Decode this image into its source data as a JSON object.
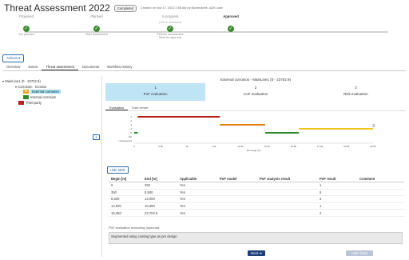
{
  "header": {
    "title": "Threat Assessment 2022",
    "badge": "Completed",
    "created": "Created on Nov 17, 2022 2:58 AM by Bumteckedt, AZM Lake"
  },
  "stepper": {
    "steps": [
      {
        "label": "Proposed",
        "sub": "",
        "action": "Set planned"
      },
      {
        "label": "Planned",
        "sub": "",
        "action": "Start assessment"
      },
      {
        "label": "In progress",
        "sub": "(100 % assessed)",
        "action": "Perform assessment\nSend for approval"
      },
      {
        "label": "Approved",
        "sub": "",
        "action": ""
      }
    ]
  },
  "actions_label": "Actions",
  "tabs": [
    "Overview",
    "Extent",
    "Threat assessment",
    "Documents",
    "Workflow History"
  ],
  "tree": {
    "root": "MainLine1 (0 - 23702.9)",
    "group": "Corrosion - Erosion",
    "items": [
      {
        "code": "M",
        "label": "External corrosion",
        "color": "#e8a21a",
        "selected": true
      },
      {
        "code": "",
        "label": "Internal corrosion",
        "color": "#2f8a2c",
        "selected": false
      },
      {
        "code": "",
        "label": "Third party",
        "color": "#b71f1f",
        "selected": false
      }
    ]
  },
  "side_toggle": "+",
  "panel": {
    "title": "External corrosion - MainLine1 (0 - 23702.9)",
    "eval_tabs": [
      {
        "num": "1",
        "label": "PoF evaluation",
        "active": true
      },
      {
        "num": "2",
        "label": "CoF evaluation",
        "active": false
      },
      {
        "num": "3",
        "label": "Risk evaluation",
        "active": false
      }
    ],
    "subtabs": [
      "Evaluation",
      "Data viewer"
    ],
    "hide_table": "Hide table",
    "columns": [
      "Begin [m]",
      "End [m]",
      "Applicable",
      "PoF model",
      "PoF analysis result",
      "PoF result",
      "Comment"
    ],
    "rows": [
      [
        "0",
        "350",
        "Yes",
        "",
        "",
        "1",
        ""
      ],
      [
        "350",
        "8,500",
        "Yes",
        "",
        "",
        "5",
        ""
      ],
      [
        "8,500",
        "13,000",
        "Yes",
        "",
        "",
        "3",
        ""
      ],
      [
        "13,000",
        "16,350",
        "Yes",
        "",
        "",
        "1",
        ""
      ],
      [
        "16,350",
        "23,702.9",
        "Yes",
        "",
        "",
        "2",
        ""
      ]
    ],
    "reasoning_label": "PoF evaluation reasoning (optional):",
    "reasoning_text": "Segmented using coating type as per design",
    "next": "Next",
    "undo": "Undo finish"
  },
  "chart_data": {
    "type": "bar",
    "xlabel": "KP range [m]",
    "ylabel": "",
    "y_ticks": [
      "1",
      "2",
      "3",
      "4",
      "5",
      "NA",
      "Unassessed"
    ],
    "x_ticks": [
      "0",
      "2.6k",
      "5k",
      "7.6k",
      "10.5k",
      "13.2k",
      "15.8k",
      "17.9k",
      "20.5k",
      "22.9k"
    ],
    "xlim": [
      0,
      23702.9
    ],
    "segments": [
      {
        "begin": 0,
        "end": 350,
        "value": 1,
        "color": "#2f8a2c"
      },
      {
        "begin": 350,
        "end": 8500,
        "value": 5,
        "color": "#b71f1f"
      },
      {
        "begin": 8500,
        "end": 13000,
        "value": 3,
        "color": "#e0820a"
      },
      {
        "begin": 13000,
        "end": 16350,
        "value": 1,
        "color": "#2f8a2c"
      },
      {
        "begin": 16350,
        "end": 23702.9,
        "value": 2,
        "color": "#f2c51d"
      }
    ]
  }
}
